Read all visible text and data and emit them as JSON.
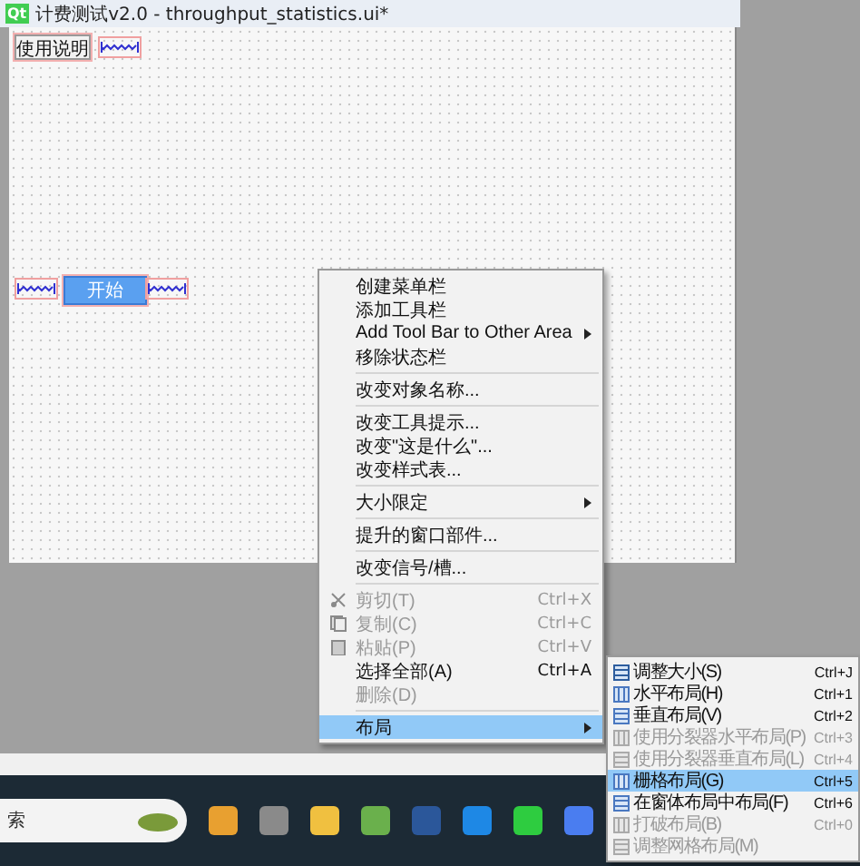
{
  "window": {
    "logo": "Qt",
    "title": "计费测试v2.0 - throughput_statistics.ui*"
  },
  "form": {
    "top_button": "使用说明",
    "start_button": "开始"
  },
  "context_menu": [
    {
      "kind": "item",
      "label": "创建菜单栏",
      "disabled": false,
      "selected": false
    },
    {
      "kind": "item",
      "label": "添加工具栏",
      "disabled": false,
      "selected": false
    },
    {
      "kind": "submenu",
      "label": "Add Tool Bar to Other Area",
      "disabled": false,
      "selected": false
    },
    {
      "kind": "item",
      "label": "移除状态栏",
      "disabled": false,
      "selected": false
    },
    {
      "kind": "separator"
    },
    {
      "kind": "item",
      "label": "改变对象名称...",
      "disabled": false,
      "selected": false
    },
    {
      "kind": "separator"
    },
    {
      "kind": "item",
      "label": "改变工具提示...",
      "disabled": false,
      "selected": false
    },
    {
      "kind": "item",
      "label": "改变\"这是什么\"...",
      "disabled": false,
      "selected": false
    },
    {
      "kind": "item",
      "label": "改变样式表...",
      "disabled": false,
      "selected": false
    },
    {
      "kind": "separator"
    },
    {
      "kind": "submenu",
      "label": "大小限定",
      "disabled": false,
      "selected": false
    },
    {
      "kind": "separator"
    },
    {
      "kind": "item",
      "label": "提升的窗口部件...",
      "disabled": false,
      "selected": false
    },
    {
      "kind": "separator"
    },
    {
      "kind": "item",
      "label": "改变信号/槽...",
      "disabled": false,
      "selected": false
    },
    {
      "kind": "separator"
    },
    {
      "kind": "icon",
      "label": "剪切(T)",
      "shortcut": "Ctrl+X",
      "disabled": true,
      "selected": false
    },
    {
      "kind": "icon",
      "label": "复制(C)",
      "shortcut": "Ctrl+C",
      "disabled": true,
      "selected": false
    },
    {
      "kind": "icon",
      "label": "粘贴(P)",
      "shortcut": "Ctrl+V",
      "disabled": true,
      "selected": false
    },
    {
      "kind": "item",
      "label": "选择全部(A)",
      "shortcut": "Ctrl+A",
      "disabled": false,
      "selected": false
    },
    {
      "kind": "item",
      "label": "删除(D)",
      "disabled": true,
      "selected": false
    },
    {
      "kind": "separator"
    },
    {
      "kind": "submenu",
      "label": "布局",
      "disabled": false,
      "selected": true
    }
  ],
  "layout_submenu": [
    {
      "label": "调整大小(S)",
      "shortcut": "Ctrl+J",
      "disabled": false,
      "selected": false
    },
    {
      "label": "水平布局(H)",
      "shortcut": "Ctrl+1",
      "disabled": false,
      "selected": false
    },
    {
      "label": "垂直布局(V)",
      "shortcut": "Ctrl+2",
      "disabled": false,
      "selected": false
    },
    {
      "label": "使用分裂器水平布局(P)",
      "shortcut": "Ctrl+3",
      "disabled": true,
      "selected": false
    },
    {
      "label": "使用分裂器垂直布局(L)",
      "shortcut": "Ctrl+4",
      "disabled": true,
      "selected": false
    },
    {
      "label": "栅格布局(G)",
      "shortcut": "Ctrl+5",
      "disabled": false,
      "selected": true
    },
    {
      "label": "在窗体布局中布局(F)",
      "shortcut": "Ctrl+6",
      "disabled": false,
      "selected": false
    },
    {
      "label": "打破布局(B)",
      "shortcut": "Ctrl+0",
      "disabled": true,
      "selected": false
    },
    {
      "label": "调整网格布局(M)",
      "disabled": true,
      "selected": false
    }
  ],
  "taskbar": {
    "search_text": "索"
  }
}
